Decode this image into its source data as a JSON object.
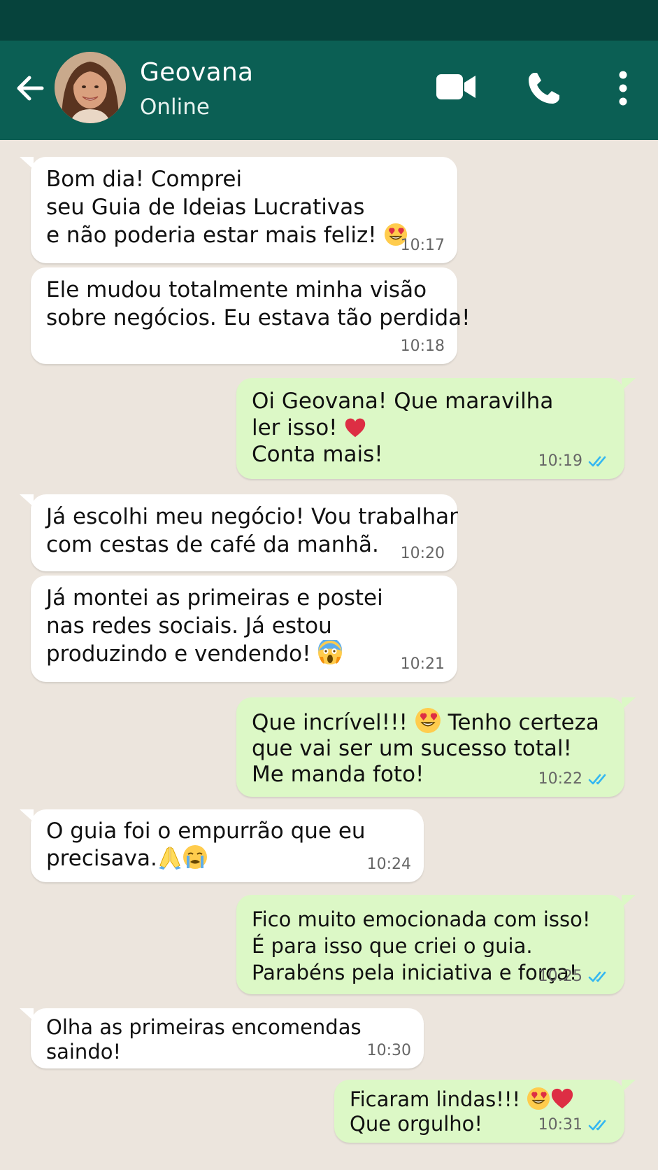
{
  "header": {
    "contact_name": "Geovana",
    "contact_status": "Online",
    "colors": {
      "status_bar": "#06433c",
      "header": "#0b5f54"
    }
  },
  "colors": {
    "background": "#ece5dd",
    "incoming_bubble": "#ffffff",
    "outgoing_bubble": "#dcf8c6",
    "read_ticks": "#34b7f1"
  },
  "icons": {
    "back": "arrow-left-icon",
    "video": "video-camera-icon",
    "call": "phone-icon",
    "menu": "kebab-menu-icon",
    "read": "double-check-icon"
  },
  "messages": [
    {
      "direction": "in",
      "lines": [
        "Bom dia! Comprei",
        "seu Guia de Ideias Lucrativas",
        "e não poderia estar mais feliz!"
      ],
      "emojis": [
        "heart-eyes"
      ],
      "time": "10:17"
    },
    {
      "direction": "in",
      "lines": [
        "Ele mudou totalmente minha visão",
        "sobre negócios. Eu estava tão perdida!"
      ],
      "time": "10:18"
    },
    {
      "direction": "out",
      "lines": [
        "Oi Geovana! Que maravilha",
        "ler isso!",
        "Conta mais!"
      ],
      "emojis": [
        "red-heart"
      ],
      "time": "10:19",
      "read": true
    },
    {
      "direction": "in",
      "lines": [
        "Já escolhi meu negócio! Vou trabalhar",
        "com cestas de café da manhã."
      ],
      "time": "10:20"
    },
    {
      "direction": "in",
      "lines": [
        "Já montei as primeiras e postei",
        "nas redes sociais. Já estou",
        "produzindo e vendendo!"
      ],
      "emojis": [
        "screaming-face"
      ],
      "time": "10:21"
    },
    {
      "direction": "out",
      "lines": [
        "Que incrível!!!",
        "Tenho certeza",
        "que vai ser um sucesso total!",
        "Me manda foto!"
      ],
      "emojis": [
        "heart-eyes"
      ],
      "time": "10:22",
      "read": true
    },
    {
      "direction": "in",
      "lines": [
        "O guia foi o empurrão que eu",
        "precisava."
      ],
      "emojis": [
        "folded-hands",
        "crying-face"
      ],
      "time": "10:24"
    },
    {
      "direction": "out",
      "lines": [
        "Fico muito emocionada com isso!",
        "É para isso que criei o guia.",
        "Parabéns pela iniciativa e força!"
      ],
      "time": "10:25",
      "read": true
    },
    {
      "direction": "in",
      "lines": [
        "Olha as primeiras encomendas",
        "saindo!"
      ],
      "time": "10:30"
    },
    {
      "direction": "out",
      "lines": [
        "Ficaram lindas!!!",
        "Que orgulho!"
      ],
      "emojis": [
        "heart-eyes",
        "red-heart"
      ],
      "time": "10:31",
      "read": true
    }
  ]
}
